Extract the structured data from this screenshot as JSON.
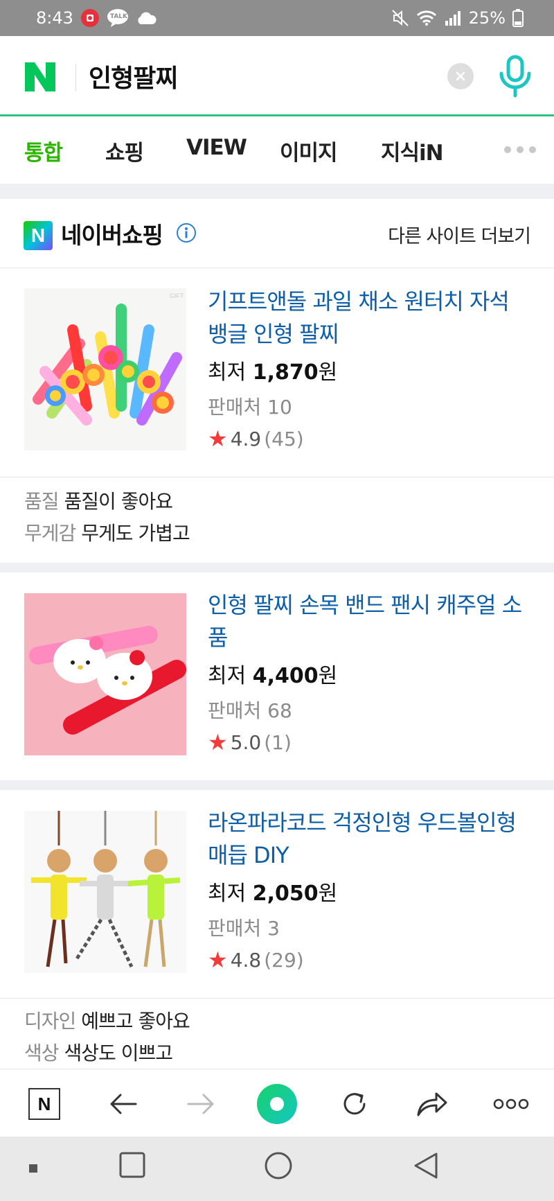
{
  "status_bar": {
    "time": "8:43",
    "talk_badge": "TALK",
    "battery": "25%",
    "icons": [
      "record-icon",
      "talk-icon",
      "cloud-icon",
      "mute-icon",
      "wifi-icon",
      "signal-icon",
      "battery-icon"
    ]
  },
  "search": {
    "logo": "N",
    "query": "인형팔찌"
  },
  "tabs": [
    {
      "label": "통합",
      "active": true
    },
    {
      "label": "쇼핑"
    },
    {
      "label": "VIEW"
    },
    {
      "label": "이미지"
    },
    {
      "label": "지식iN"
    }
  ],
  "shopping": {
    "logo": "N",
    "title": "네이버쇼핑",
    "more_label": "다른 사이트 더보기"
  },
  "products": [
    {
      "title": "기프트앤돌 과일 채소 원터치 자석 뱅글 인형 팔찌",
      "price_prefix": "최저 ",
      "price": "1,870",
      "price_unit": "원",
      "sellers": "판매처 10",
      "rating": "4.9",
      "reviews_count": "(45)",
      "review_tags": [
        {
          "key": "품질",
          "value": "품질이 좋아요"
        },
        {
          "key": "무게감",
          "value": "무게도 가볍고"
        }
      ]
    },
    {
      "title": "인형 팔찌 손목 밴드 팬시 캐주얼 소품",
      "price_prefix": "최저 ",
      "price": "4,400",
      "price_unit": "원",
      "sellers": "판매처 68",
      "rating": "5.0",
      "reviews_count": "(1)"
    },
    {
      "title": "라온파라코드 걱정인형 우드볼인형 매듭 DIY",
      "price_prefix": "최저 ",
      "price": "2,050",
      "price_unit": "원",
      "sellers": "판매처 3",
      "rating": "4.8",
      "reviews_count": "(29)",
      "review_tags": [
        {
          "key": "디자인",
          "value": "예쁘고 좋아요"
        },
        {
          "key": "색상",
          "value": "색상도 이쁘고"
        }
      ]
    }
  ],
  "toolbar": {
    "home_logo": "N",
    "icons": [
      "naver-home-icon",
      "back-icon",
      "forward-icon",
      "green-dot-icon",
      "refresh-icon",
      "share-icon",
      "more-icon"
    ]
  },
  "colors": {
    "naver_green": "#03c75a",
    "tab_active": "#2db400",
    "link_blue": "#0c5ea8",
    "star_red": "#f43b3b"
  }
}
